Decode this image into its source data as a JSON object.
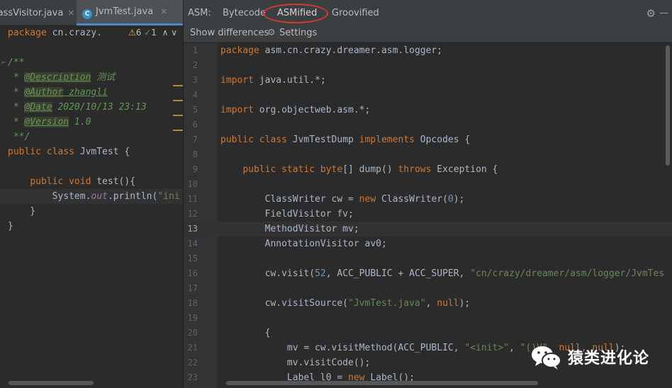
{
  "left_editor": {
    "tabs": [
      {
        "label": "lassVisitor.java",
        "close": "×"
      },
      {
        "label": "JvmTest.java",
        "close": "×",
        "icon": "class-c-icon"
      }
    ],
    "inspections": {
      "warn_icon": "⚠",
      "warnings": "6",
      "ok_icon": "✓",
      "ok": "1",
      "up": "∧",
      "down": "∨"
    },
    "lines": {
      "l1_kw": "package",
      "l1_rest": " cn.crazy.",
      "l3": "/**",
      "l4_a": " * ",
      "l4_tag": "@Description",
      "l4_text": " 测试",
      "l5_a": " * ",
      "l5_tag": "@Author",
      "l5_text": " zhangli",
      "l6_a": " * ",
      "l6_tag": "@Date",
      "l6_text": " 2020/10/13 23:13",
      "l7_a": " * ",
      "l7_tag": "@Version",
      "l7_text": " 1.0",
      "l8": " **/",
      "l9_kw": "public class",
      "l9_rest": " JvmTest {",
      "l11_pre": "    ",
      "l11_kw": "public void",
      "l11_rest": " test(){",
      "l12_a": "        System.",
      "l12_out": "out",
      "l12_b": ".println(",
      "l12_str": "\"ini",
      "l13": "    }",
      "l14": "}"
    }
  },
  "right_panel": {
    "asm_label": "ASM:",
    "tabs": [
      "Bytecode",
      "ASMified",
      "Groovified"
    ],
    "active_tab": "ASMified",
    "settings_icon": "⚙",
    "minimize_icon": "—",
    "show_differences": "Show differences",
    "settings_label": "Settings",
    "gear_icon": "⚙",
    "current_line": "13",
    "line_numbers": [
      "1",
      "2",
      "3",
      "4",
      "5",
      "6",
      "7",
      "8",
      "9",
      "10",
      "11",
      "12",
      "13",
      "14",
      "15",
      "16",
      "17",
      "18",
      "19",
      "20",
      "21",
      "22",
      "23"
    ],
    "code": {
      "c1_kw": "package",
      "c1_rest": " asm.cn.crazy.dreamer.asm.logger;",
      "c3_kw": "import",
      "c3_rest": " java.util.*;",
      "c5_kw": "import",
      "c5_rest": " org.objectweb.asm.*;",
      "c7_kw": "public class",
      "c7_mid": " JvmTestDump ",
      "c7_kw2": "implements",
      "c7_rest": " Opcodes {",
      "c9_pre": "    ",
      "c9_kw": "public static byte",
      "c9_mid": "[] dump() ",
      "c9_kw2": "throws",
      "c9_rest": " Exception {",
      "c11_a": "        ClassWriter cw = ",
      "c11_kw": "new",
      "c11_b": " ClassWriter(",
      "c11_num": "0",
      "c11_c": ");",
      "c12": "        FieldVisitor fv;",
      "c13": "        MethodVisitor mv;",
      "c14": "        AnnotationVisitor av0;",
      "c16_a": "        cw.visit(",
      "c16_num": "52",
      "c16_b": ", ACC_PUBLIC + ACC_SUPER, ",
      "c16_str": "\"cn/crazy/dreamer/asm/logger/JvmTes",
      "c18_a": "        cw.visitSource(",
      "c18_str": "\"JvmTest.java\"",
      "c18_b": ", ",
      "c18_kw": "null",
      "c18_c": ");",
      "c20": "        {",
      "c21_a": "            mv = cw.visitMethod(ACC_PUBLIC, ",
      "c21_str1": "\"<init>\"",
      "c21_b": ", ",
      "c21_str2": "\"()V\"",
      "c21_c": ", ",
      "c21_kw": "null, null",
      "c21_d": ");",
      "c22": "            mv.visitCode();",
      "c23_a": "            Label l0 = ",
      "c23_kw": "new",
      "c23_b": " Label();"
    }
  },
  "watermark": {
    "text": "猿类进化论",
    "icon": "wechat-logo-icon"
  }
}
